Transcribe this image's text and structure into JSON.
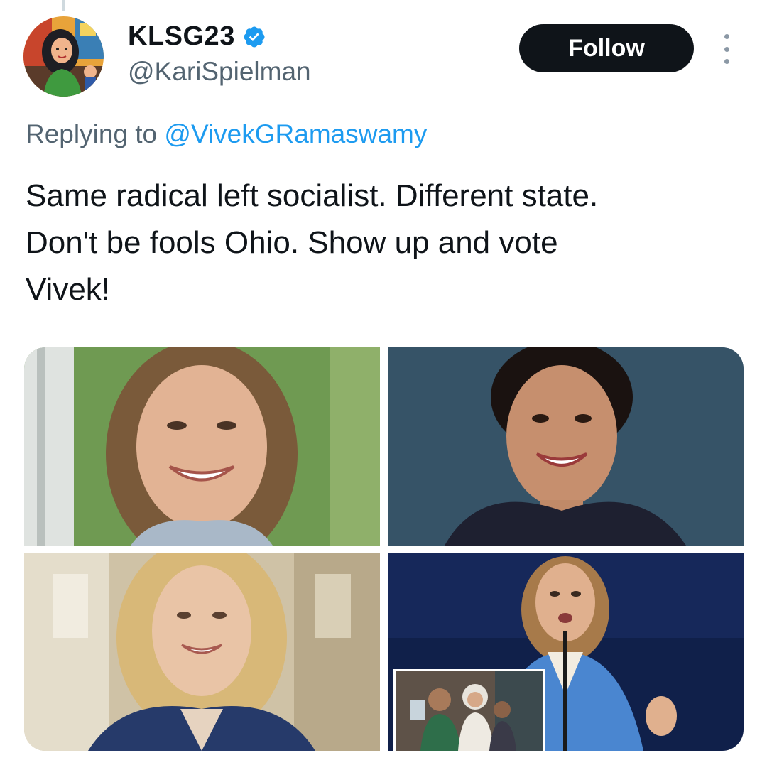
{
  "tweet": {
    "author": {
      "display_name": "KLSG23",
      "handle": "@KariSpielman",
      "verified": true,
      "verified_color": "#1d9bf0",
      "avatar_icon": "comic-woman-avatar"
    },
    "follow_label": "Follow",
    "more_icon": "more-vertical-icon",
    "reply": {
      "prefix": "Replying to ",
      "mention": "@VivekGRamaswamy"
    },
    "text": "Same radical left socialist.  Different state.\nDon't be fools Ohio.  Show up and vote\nVivek!",
    "media": [
      {
        "name": "photo-woman-smiling-outdoors"
      },
      {
        "name": "photo-woman-dark-hair-smiling"
      },
      {
        "name": "photo-woman-blonde-blazer"
      },
      {
        "name": "photo-woman-speaking-podium"
      }
    ]
  },
  "colors": {
    "text_primary": "#0f1419",
    "text_secondary": "#536471",
    "link": "#1d9bf0",
    "button_bg": "#0f1419"
  }
}
